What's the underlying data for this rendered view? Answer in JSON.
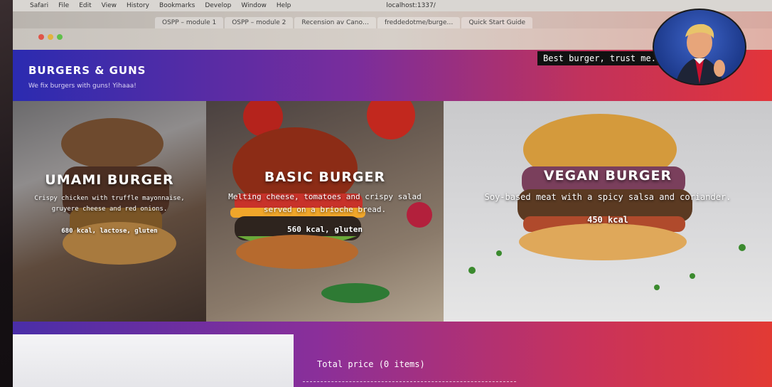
{
  "browser": {
    "menu": [
      "Safari",
      "File",
      "Edit",
      "View",
      "History",
      "Bookmarks",
      "Develop",
      "Window",
      "Help"
    ],
    "address": "localhost:1337/",
    "tabs": [
      "OSPP – module 1",
      "OSPP – module 2",
      "Recension av Cano…",
      "freddedotme/burge…",
      "Quick Start Guide"
    ]
  },
  "header": {
    "title": "BURGERS & GUNS",
    "subtitle": "We fix burgers with guns! Yihaaa!",
    "quote": "Best burger, trust me."
  },
  "cards": [
    {
      "title": "UMAMI BURGER",
      "description": "Crispy chicken with truffle mayonnaise, gruyere cheese and red onions.",
      "meta": "680 kcal, lactose, gluten"
    },
    {
      "title": "BASIC BURGER",
      "description": "Melting cheese, tomatoes and crispy salad served on a brioche bread.",
      "meta": "560 kcal, gluten"
    },
    {
      "title": "VEGAN BURGER",
      "description": "Soy-based meat with a spicy salsa and coriander.",
      "meta": "450 kcal"
    }
  ],
  "order": {
    "total_label": "Total price (0 items)"
  },
  "colors": {
    "header_start": "#2b2bb0",
    "header_end": "#e2343a"
  }
}
